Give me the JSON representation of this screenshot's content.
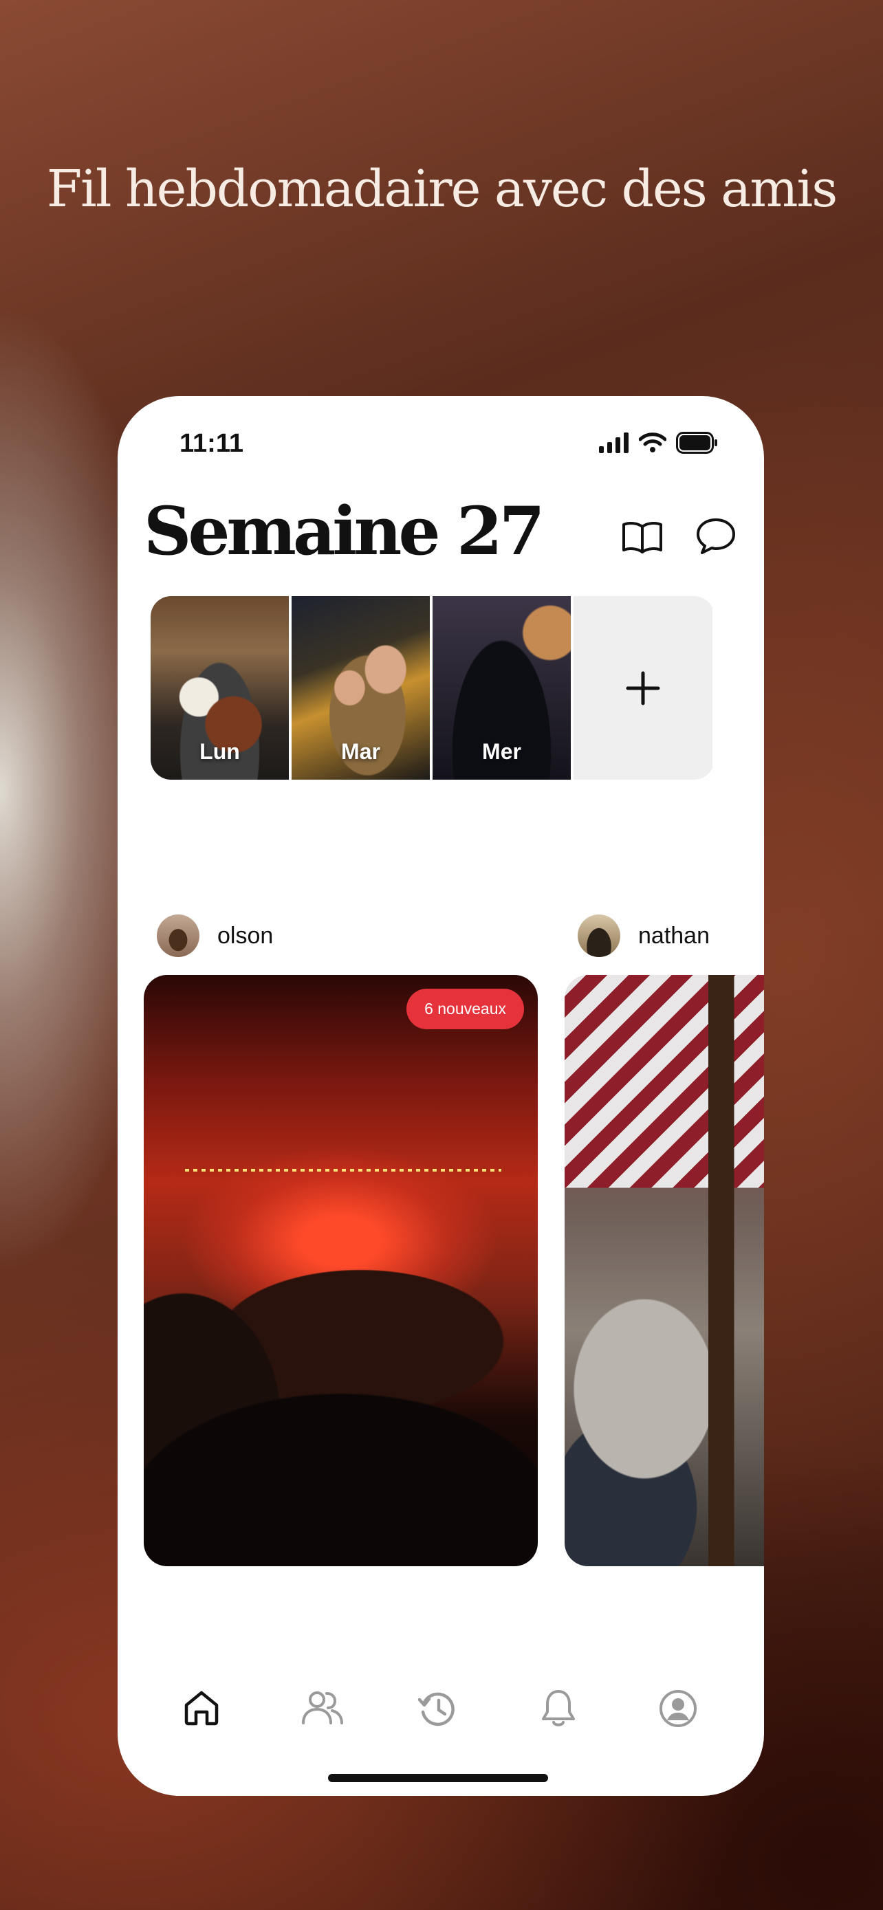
{
  "headline": "Fil hebdomadaire avec des amis",
  "status": {
    "time": "11:11"
  },
  "header": {
    "title": "Semaine 27",
    "icons": [
      "book-icon",
      "chat-bubble-icon"
    ]
  },
  "days": [
    {
      "label": "Lun"
    },
    {
      "label": "Mar"
    },
    {
      "label": "Mer"
    }
  ],
  "add_icon": "plus-icon",
  "posts": [
    {
      "user": "olson",
      "badge": "6 nouveaux"
    },
    {
      "user": "nathan"
    }
  ],
  "tabs": [
    {
      "icon": "home-icon",
      "active": true
    },
    {
      "icon": "friends-icon",
      "active": false
    },
    {
      "icon": "history-icon",
      "active": false
    },
    {
      "icon": "bell-icon",
      "active": false
    },
    {
      "icon": "profile-icon",
      "active": false
    }
  ],
  "colors": {
    "badge": "#e5323b",
    "inactive_tab": "#9a9a9a",
    "active_tab": "#111111"
  }
}
